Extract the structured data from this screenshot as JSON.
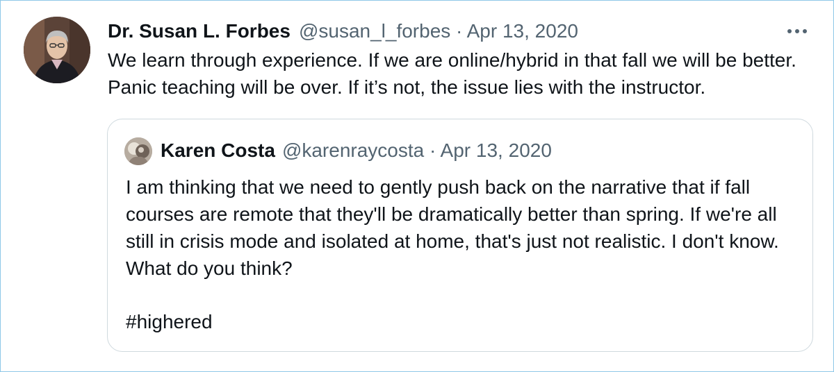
{
  "tweet": {
    "author_name": "Dr. Susan L. Forbes",
    "handle_date": "@susan_l_forbes · Apr 13, 2020",
    "text_lines": [
      "We learn through experience. If we are online/hybrid in that fall we will be better.",
      "Panic teaching will be over.  If it’s not, the issue lies with the instructor."
    ],
    "more_icon": "more-horizontal-icon"
  },
  "quoted_tweet": {
    "author_name": "Karen Costa",
    "handle_date": "@karenraycosta · Apr 13, 2020",
    "text_lines": [
      "I am thinking that we need to gently push back on the narrative that if fall",
      "courses are remote that they'll be dramatically better than spring. If we're all",
      "still in crisis mode and isolated at home, that's just not realistic. I don't know.",
      "What do you think?"
    ],
    "hashtag": "#highered"
  },
  "colors": {
    "text": "#0f1419",
    "secondary": "#536471",
    "quote_border": "#cfd9de",
    "frame_border": "#8ec8e8"
  }
}
